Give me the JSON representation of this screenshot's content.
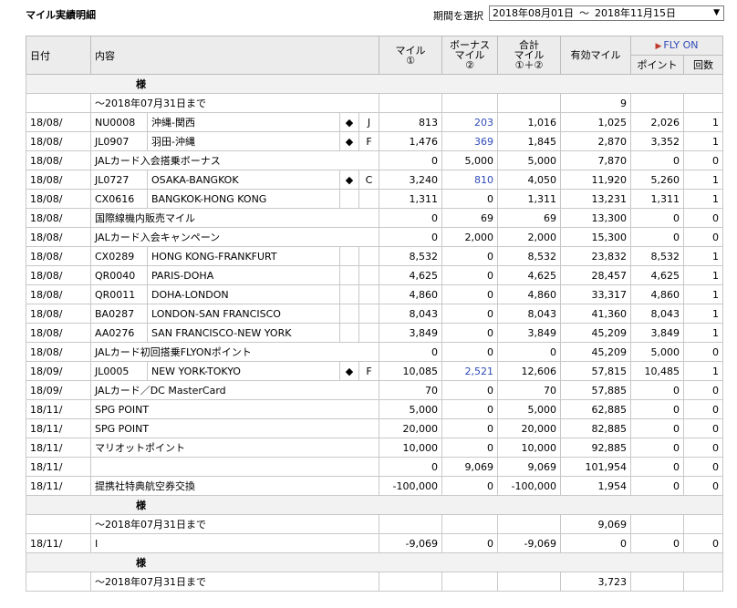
{
  "header": {
    "title": "マイル実績明細",
    "period_label": "期間を選択",
    "period_from": "2018年08月01日",
    "period_sep": "～",
    "period_to": "2018年11月15日"
  },
  "columns": {
    "date": "日付",
    "content": "内容",
    "mile_l1": "マイル",
    "mile_l2": "①",
    "bonus_l1": "ボーナス",
    "bonus_l2": "マイル",
    "bonus_l3": "②",
    "total_l1": "合計",
    "total_l2": "マイル",
    "total_l3": "①＋②",
    "effective": "有効マイル",
    "flyon": "FLY ON",
    "points": "ポイント",
    "count": "回数"
  },
  "sections": [
    {
      "name": "様",
      "carry": {
        "label": "～2018年07月31日まで",
        "effective": "9"
      },
      "rows": [
        {
          "date": "18/08/",
          "flight": "NU0008",
          "route": "沖縄-関西",
          "mark": "◆",
          "cls": "J",
          "mile": "813",
          "bonus": "203",
          "total": "1,016",
          "effective": "1,025",
          "points": "2,026",
          "count": "1"
        },
        {
          "date": "18/08/",
          "flight": "JL0907",
          "route": "羽田-沖縄",
          "mark": "◆",
          "cls": "F",
          "mile": "1,476",
          "bonus": "369",
          "total": "1,845",
          "effective": "2,870",
          "points": "3,352",
          "count": "1"
        },
        {
          "date": "18/08/",
          "desc": "JALカード入会搭乗ボーナス",
          "mile": "0",
          "bonus": "5,000",
          "total": "5,000",
          "effective": "7,870",
          "points": "0",
          "count": "0"
        },
        {
          "date": "18/08/",
          "flight": "JL0727",
          "route": "OSAKA-BANGKOK",
          "mark": "◆",
          "cls": "C",
          "mile": "3,240",
          "bonus": "810",
          "total": "4,050",
          "effective": "11,920",
          "points": "5,260",
          "count": "1"
        },
        {
          "date": "18/08/",
          "flight": "CX0616",
          "route": "BANGKOK-HONG KONG",
          "mark": "",
          "cls": "",
          "mile": "1,311",
          "bonus": "0",
          "total": "1,311",
          "effective": "13,231",
          "points": "1,311",
          "count": "1"
        },
        {
          "date": "18/08/",
          "desc": "国際線機内販売マイル",
          "mile": "0",
          "bonus": "69",
          "total": "69",
          "effective": "13,300",
          "points": "0",
          "count": "0"
        },
        {
          "date": "18/08/",
          "desc": "JALカード入会キャンペーン",
          "mile": "0",
          "bonus": "2,000",
          "total": "2,000",
          "effective": "15,300",
          "points": "0",
          "count": "0"
        },
        {
          "date": "18/08/",
          "flight": "CX0289",
          "route": "HONG KONG-FRANKFURT",
          "mark": "",
          "cls": "",
          "mile": "8,532",
          "bonus": "0",
          "total": "8,532",
          "effective": "23,832",
          "points": "8,532",
          "count": "1"
        },
        {
          "date": "18/08/",
          "flight": "QR0040",
          "route": "PARIS-DOHA",
          "mark": "",
          "cls": "",
          "mile": "4,625",
          "bonus": "0",
          "total": "4,625",
          "effective": "28,457",
          "points": "4,625",
          "count": "1"
        },
        {
          "date": "18/08/",
          "flight": "QR0011",
          "route": "DOHA-LONDON",
          "mark": "",
          "cls": "",
          "mile": "4,860",
          "bonus": "0",
          "total": "4,860",
          "effective": "33,317",
          "points": "4,860",
          "count": "1"
        },
        {
          "date": "18/08/",
          "flight": "BA0287",
          "route": "LONDON-SAN FRANCISCO",
          "mark": "",
          "cls": "",
          "mile": "8,043",
          "bonus": "0",
          "total": "8,043",
          "effective": "41,360",
          "points": "8,043",
          "count": "1"
        },
        {
          "date": "18/08/",
          "flight": "AA0276",
          "route": "SAN FRANCISCO-NEW YORK",
          "mark": "",
          "cls": "",
          "mile": "3,849",
          "bonus": "0",
          "total": "3,849",
          "effective": "45,209",
          "points": "3,849",
          "count": "1"
        },
        {
          "date": "18/08/",
          "desc": "JALカード初回搭乗FLYONポイント",
          "mile": "0",
          "bonus": "0",
          "total": "0",
          "effective": "45,209",
          "points": "5,000",
          "count": "0"
        },
        {
          "date": "18/09/",
          "flight": "JL0005",
          "route": "NEW YORK-TOKYO",
          "mark": "◆",
          "cls": "F",
          "mile": "10,085",
          "bonus": "2,521",
          "total": "12,606",
          "effective": "57,815",
          "points": "10,485",
          "count": "1"
        },
        {
          "date": "18/09/",
          "desc": "JALカード／DC MasterCard",
          "mile": "70",
          "bonus": "0",
          "total": "70",
          "effective": "57,885",
          "points": "0",
          "count": "0"
        },
        {
          "date": "18/11/",
          "desc": "SPG POINT",
          "mile": "5,000",
          "bonus": "0",
          "total": "5,000",
          "effective": "62,885",
          "points": "0",
          "count": "0"
        },
        {
          "date": "18/11/",
          "desc": "SPG POINT",
          "mile": "20,000",
          "bonus": "0",
          "total": "20,000",
          "effective": "82,885",
          "points": "0",
          "count": "0"
        },
        {
          "date": "18/11/",
          "desc": "マリオットポイント",
          "mile": "10,000",
          "bonus": "0",
          "total": "10,000",
          "effective": "92,885",
          "points": "0",
          "count": "0"
        },
        {
          "date": "18/11/",
          "desc": "",
          "mile": "0",
          "bonus": "9,069",
          "total": "9,069",
          "effective": "101,954",
          "points": "0",
          "count": "0"
        },
        {
          "date": "18/11/",
          "desc": "提携社特典航空券交換",
          "mile": "-100,000",
          "bonus": "0",
          "total": "-100,000",
          "effective": "1,954",
          "points": "0",
          "count": "0"
        }
      ]
    },
    {
      "name": "様",
      "carry": {
        "label": "～2018年07月31日まで",
        "effective": "9,069"
      },
      "rows": [
        {
          "date": "18/11/",
          "desc": "I",
          "mile": "-9,069",
          "bonus": "0",
          "total": "-9,069",
          "effective": "0",
          "points": "0",
          "count": "0"
        }
      ]
    },
    {
      "name": "様",
      "carry": {
        "label": "～2018年07月31日まで",
        "effective": "3,723"
      },
      "rows": []
    }
  ]
}
